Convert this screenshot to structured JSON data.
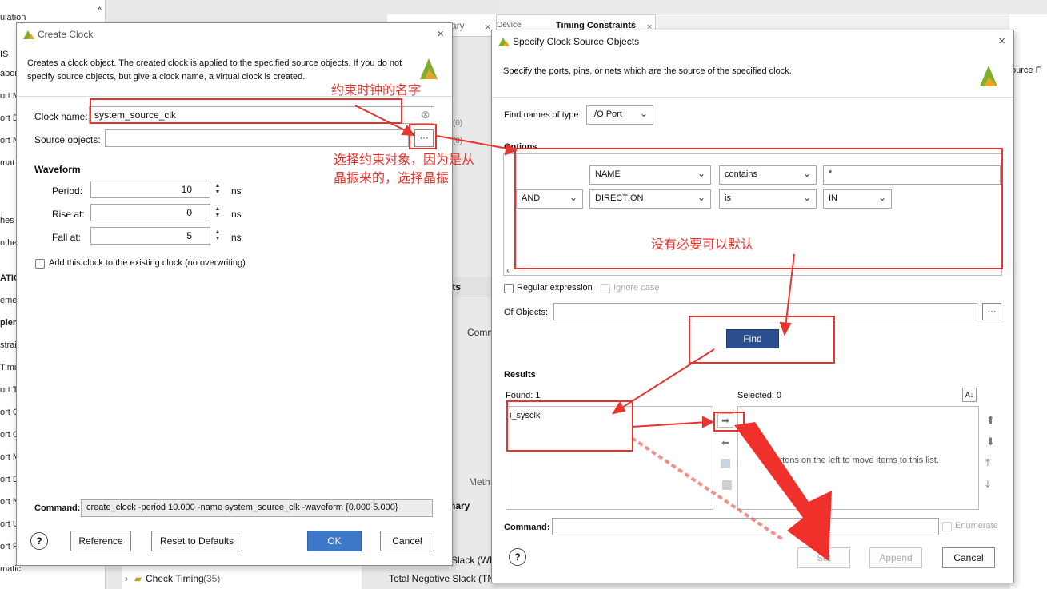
{
  "background": {
    "left_items": [
      "ulation",
      "IS",
      "abora",
      "ort M",
      "ort D",
      "ort N",
      "mat",
      "hes",
      "nthe",
      "ATIO",
      "eme",
      "plem",
      "strai",
      "Timi",
      "ort Ti",
      "ort C",
      "ort C",
      "ort M",
      "ort D",
      "ort N",
      "ort U",
      "ort P",
      "matic"
    ],
    "tabs": [
      "ary",
      "Device",
      "Timing Constraints"
    ],
    "mid_labels": {
      "count_a": "(0)",
      "count_b": "(0)",
      "its": "its",
      "comm": "Comm",
      "meth": "Meth",
      "nary": "nary",
      "slack_wn": "Slack (WN",
      "total_neg": "Total Negative Slack (TNS",
      "check_timing": "Check Timing",
      "check_timing_count": "(35)",
      "source_f": "ource F"
    }
  },
  "create_clock": {
    "title": "Create Clock",
    "description": "Creates a clock object. The created clock is applied to the specified source objects. If you do not specify source objects, but give a clock name, a virtual clock is created.",
    "clock_name_label": "Clock name:",
    "clock_name_value": "system_source_clk",
    "source_objects_label": "Source objects:",
    "source_objects_value": "",
    "browse_label": "···",
    "waveform_heading": "Waveform",
    "period_label": "Period:",
    "period_value": "10",
    "rise_label": "Rise at:",
    "rise_value": "0",
    "fall_label": "Fall at:",
    "fall_value": "5",
    "unit": "ns",
    "add_clock_label": "Add this clock to the existing clock (no overwriting)",
    "command_label": "Command:",
    "command_value": "create_clock -period 10.000 -name system_source_clk -waveform {0.000 5.000}",
    "help_label": "?",
    "reference_label": "Reference",
    "reset_label": "Reset to Defaults",
    "ok_label": "OK",
    "cancel_label": "Cancel"
  },
  "specify_source": {
    "title": "Specify Clock Source Objects",
    "description": "Specify the ports, pins, or nets which are the source of the specified clock.",
    "find_type_label": "Find names of type:",
    "find_type_value": "I/O Port",
    "options_heading": "Options",
    "row1": {
      "field": "NAME",
      "op": "contains",
      "value": "*"
    },
    "row2": {
      "logic": "AND",
      "field": "DIRECTION",
      "op": "is",
      "value": "IN"
    },
    "regex_label": "Regular expression",
    "ignore_case_label": "Ignore case",
    "of_objects_label": "Of Objects:",
    "find_label": "Find",
    "results_heading": "Results",
    "found_label": "Found: 1",
    "selected_label": "Selected: 0",
    "found_items": [
      "i_sysclk"
    ],
    "hint_text": "uttons on the left to move items to this list.",
    "command_label": "Command:",
    "enumerate_label": "Enumerate",
    "set_label": "Set",
    "append_label": "Append",
    "cancel_label": "Cancel",
    "help_label": "?"
  },
  "annotations": {
    "clock_name_note": "约束时钟的名字",
    "source_note_line1": "选择约束对象，因为是从",
    "source_note_line2": "晶振来的，选择晶振",
    "options_note": "没有必要可以默认"
  },
  "colors": {
    "annotation_red": "#e8342f",
    "ok_blue": "#3e79c9",
    "find_navy": "#2b4f8e",
    "logo_green": "#7fae2b",
    "logo_orange": "#e8a32a"
  }
}
